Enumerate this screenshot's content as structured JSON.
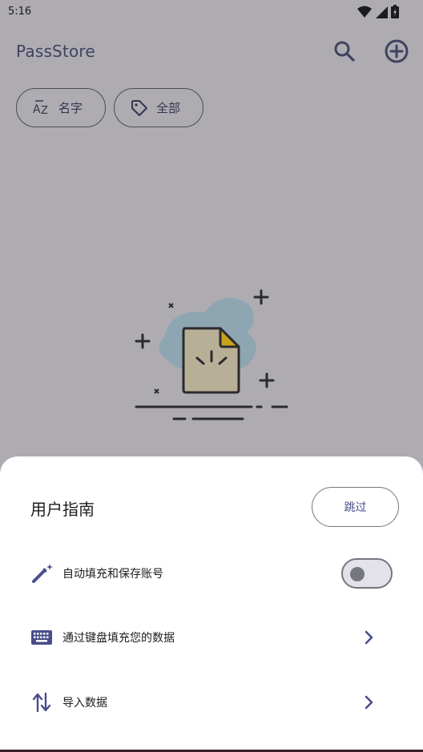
{
  "status_bar": {
    "time": "5:16",
    "icons": [
      "wifi-icon",
      "signal-icon",
      "battery-icon"
    ]
  },
  "app_bar": {
    "title": "PassStore",
    "actions": [
      "search-icon",
      "add-circle-icon"
    ]
  },
  "filters": {
    "sort_chip": {
      "icon": "sort-az-icon",
      "label": "名字"
    },
    "tag_chip": {
      "icon": "tag-icon",
      "label": "全部"
    }
  },
  "empty_state": {
    "illustration": "empty-document-illustration"
  },
  "guide_sheet": {
    "title": "用户指南",
    "skip_label": "跳过",
    "items": [
      {
        "icon": "magic-wand-icon",
        "label": "自动填充和保存账号",
        "control": "toggle",
        "enabled": false
      },
      {
        "icon": "keyboard-icon",
        "label": "通过键盘填充您的数据",
        "control": "chevron"
      },
      {
        "icon": "import-export-icon",
        "label": "导入数据",
        "control": "chevron"
      }
    ]
  },
  "colors": {
    "scrim_background": "#aeacb1",
    "primary": "#4a4d8a",
    "sheet_background": "#ffffff"
  }
}
